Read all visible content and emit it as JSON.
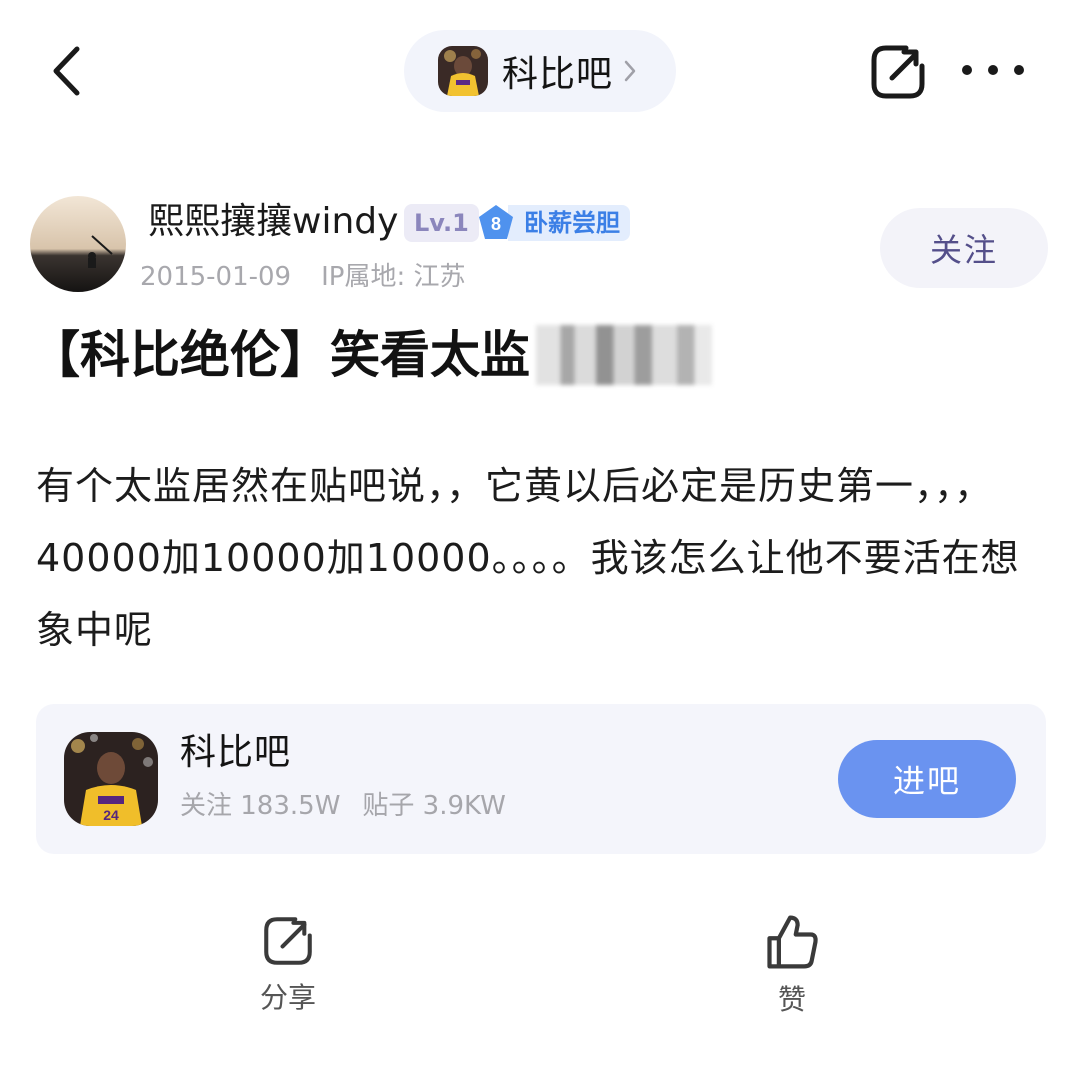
{
  "header": {
    "forum_name": "科比吧"
  },
  "author": {
    "name": "熙熙攘攘windy",
    "level": "Lv.1",
    "badge_number": "8",
    "badge_title": "卧薪尝胆",
    "date": "2015-01-09",
    "ip_location": "IP属地: 江苏",
    "follow_label": "关注"
  },
  "post": {
    "title": "【科比绝伦】笑看太监",
    "body": "有个太监居然在贴吧说，，它黄以后必定是历史第一，，，40000加10000加10000。。。。我该怎么让他不要活在想象中呢"
  },
  "forum_card": {
    "name": "科比吧",
    "followers": "关注 183.5W",
    "posts": "贴子 3.9KW",
    "enter_label": "进吧"
  },
  "actions": {
    "share_label": "分享",
    "like_label": "赞"
  },
  "colors": {
    "accent_blue": "#6a93f0",
    "level_badge": "#8b86bc",
    "title_badge": "#3b7fe6"
  }
}
